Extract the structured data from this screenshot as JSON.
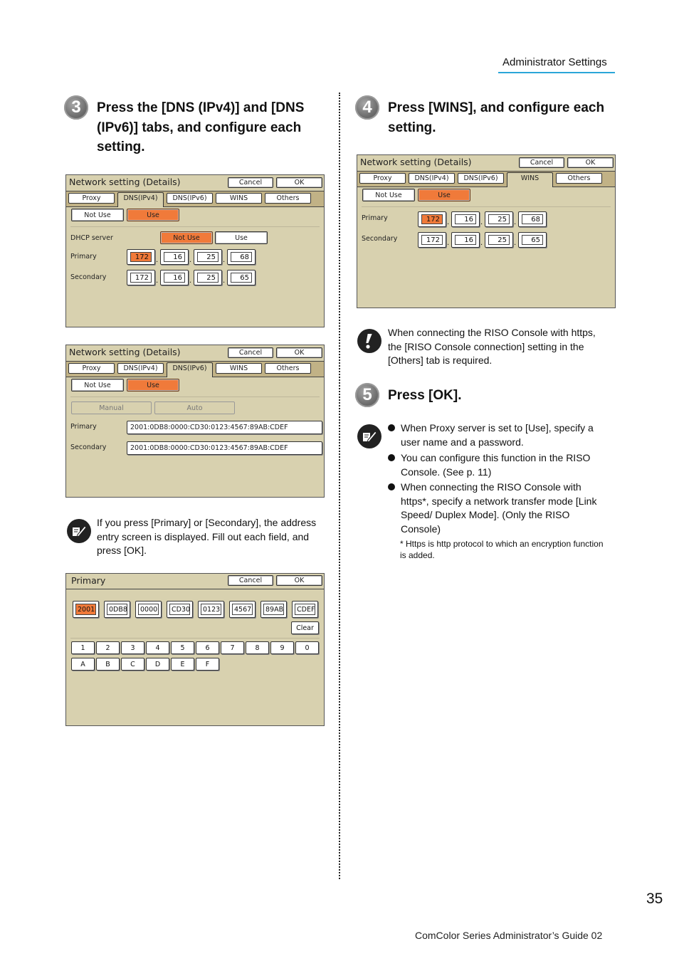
{
  "header": {
    "title": "Administrator Settings"
  },
  "step3": {
    "number": "3",
    "title_lines": [
      "Press the [DNS (IPv4)] and [DNS",
      "(IPv6)] tabs, and configure each",
      "setting."
    ]
  },
  "step4": {
    "number": "4",
    "title_lines": [
      "Press [WINS], and configure each",
      "setting."
    ]
  },
  "step5": {
    "number": "5",
    "title": "Press [OK]."
  },
  "panel_common": {
    "title": "Network setting (Details)",
    "cancel": "Cancel",
    "ok": "OK",
    "tabs": [
      "Proxy",
      "DNS(IPv4)",
      "DNS(IPv6)",
      "WINS",
      "Others"
    ],
    "not_use": "Not Use",
    "use": "Use",
    "primary": "Primary",
    "secondary": "Secondary"
  },
  "panel_ipv4": {
    "active_tab": "DNS(IPv4)",
    "dhcp_label": "DHCP server",
    "dhcp_not_use": "Not Use",
    "dhcp_use": "Use",
    "primary": [
      "172",
      "16",
      "25",
      "68"
    ],
    "secondary": [
      "172",
      "16",
      "25",
      "65"
    ]
  },
  "panel_ipv6": {
    "active_tab": "DNS(IPv6)",
    "manual": "Manual",
    "auto": "Auto",
    "primary": "2001:0DB8:0000:CD30:0123:4567:89AB:CDEF",
    "secondary": "2001:0DB8:0000:CD30:0123:4567:89AB:CDEF"
  },
  "note_step3": "If you press [Primary] or [Secondary], the address entry screen is displayed. Fill out each field, and press [OK].",
  "panel_primary": {
    "title": "Primary",
    "cancel": "Cancel",
    "ok": "OK",
    "segments": [
      "2001",
      "0DB8",
      "0000",
      "CD30",
      "0123",
      "4567",
      "89AB",
      "CDEF"
    ],
    "clear": "Clear",
    "keys_row1": [
      "1",
      "2",
      "3",
      "4",
      "5",
      "6",
      "7",
      "8",
      "9",
      "0"
    ],
    "keys_row2": [
      "A",
      "B",
      "C",
      "D",
      "E",
      "F"
    ]
  },
  "panel_wins": {
    "active_tab": "WINS",
    "primary": [
      "172",
      "16",
      "25",
      "68"
    ],
    "secondary": [
      "172",
      "16",
      "25",
      "65"
    ]
  },
  "important_note": "When connecting the RISO Console with https, the [RISO Console connection] setting in the [Others] tab is required.",
  "step5_notes": [
    "When Proxy server is set to [Use], specify a user name and a password.",
    "You can configure this function in the RISO Console. (See p. 11)",
    "When connecting the RISO Console with https*, specify a network transfer mode [Link Speed/ Duplex Mode]. (Only the RISO Console)"
  ],
  "footnote": "*  Https is http protocol to which an encryption function is added.",
  "page_number": "35",
  "footer": "ComColor Series  Administrator’s Guide  02"
}
